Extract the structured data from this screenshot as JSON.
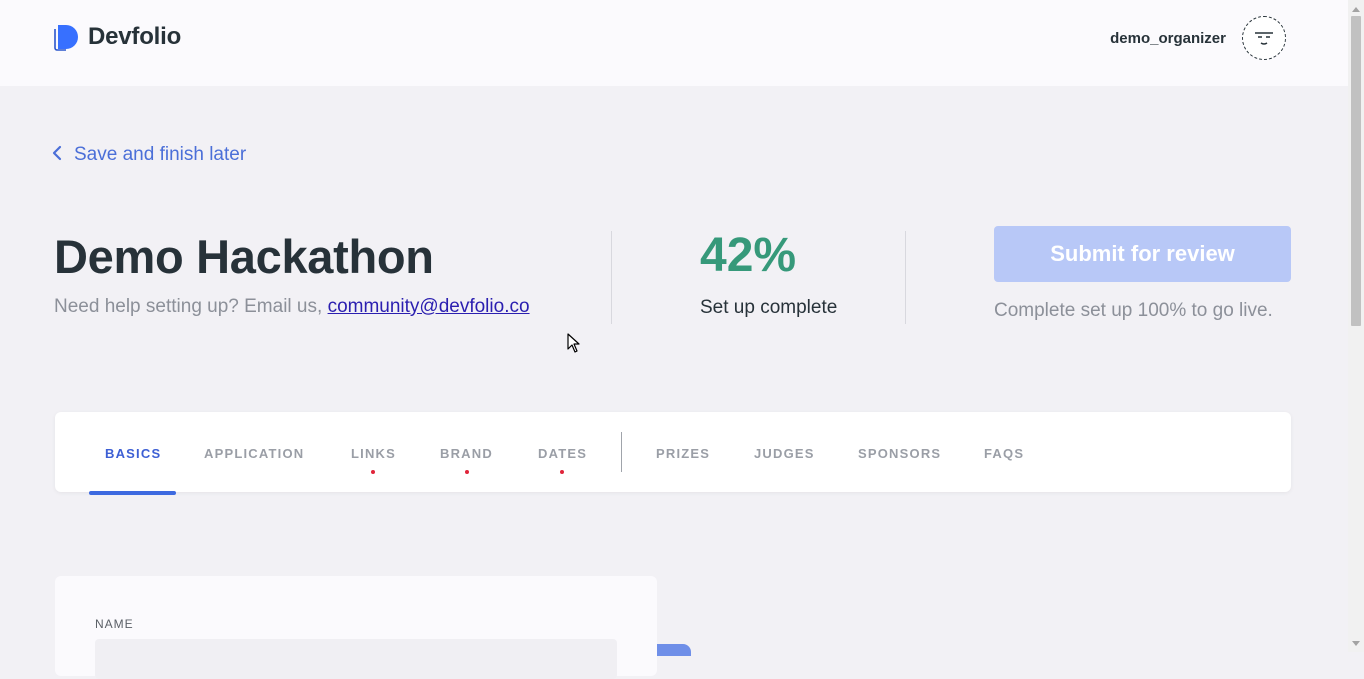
{
  "header": {
    "logo_text": "Devfolio",
    "username": "demo_organizer",
    "logo_color": "#3770ff"
  },
  "back_link": {
    "label": "Save and finish later",
    "icon": "chevron-left-icon"
  },
  "hackathon": {
    "title": "Demo Hackathon",
    "help_prefix": "Need help setting up? Email us, ",
    "help_email": "community@devfolio.co"
  },
  "progress": {
    "value": "42%",
    "label": "Set up complete",
    "color": "#36997a"
  },
  "submit": {
    "label": "Submit for review",
    "note": "Complete set up 100% to go live."
  },
  "tabs": [
    {
      "label": "BASICS",
      "active": true,
      "dot": false
    },
    {
      "label": "APPLICATION",
      "active": false,
      "dot": false
    },
    {
      "label": "LINKS",
      "active": false,
      "dot": true
    },
    {
      "label": "BRAND",
      "active": false,
      "dot": true
    },
    {
      "label": "DATES",
      "active": false,
      "dot": true
    },
    {
      "label": "PRIZES",
      "active": false,
      "dot": false
    },
    {
      "label": "JUDGES",
      "active": false,
      "dot": false
    },
    {
      "label": "SPONSORS",
      "active": false,
      "dot": false
    },
    {
      "label": "FAQS",
      "active": false,
      "dot": false
    }
  ],
  "form": {
    "name_label": "NAME",
    "name_value": ""
  },
  "colors": {
    "accent": "#3d5fd4",
    "warning_dot": "#e0243a",
    "disabled_button": "#b8c8f7"
  }
}
